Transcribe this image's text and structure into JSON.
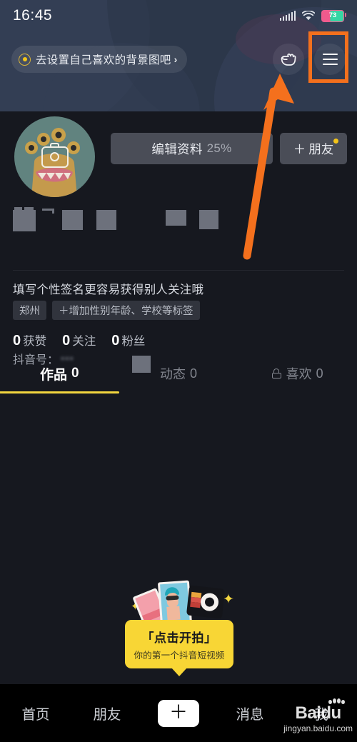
{
  "status_bar": {
    "time": "16:45",
    "signal_icon": "cellular-signal-icon",
    "wifi_icon": "wifi-icon",
    "battery_icon": "battery-icon",
    "battery_level": "73"
  },
  "banner": {
    "chip_text": "去设置自己喜欢的背景图吧",
    "chip_arrow": "›",
    "chip_dot_icon": "yellow-dot-icon",
    "hand_icon": "pointing-hand-icon",
    "menu_icon": "hamburger-menu-icon",
    "background_color": "#2f3b4e"
  },
  "profile": {
    "avatar_icon": "avatar-camera-icon",
    "avatar_bg": "#61837f",
    "edit_button": "编辑资料",
    "edit_percent": "25%",
    "friend_button_plus": "＋",
    "friend_button": "朋友",
    "friend_badge_color": "#f5c518",
    "username_redacted": true,
    "douyin_id_label": "抖音号：",
    "douyin_id_value": "•••",
    "signature_placeholder": "填写个性签名更容易获得别人关注哦",
    "tags": [
      {
        "label": "郑州",
        "name": "tag-city"
      },
      {
        "label": "＋增加性别年龄、学校等标签",
        "name": "tag-add-attributes"
      }
    ],
    "stats": [
      {
        "num": "0",
        "label": "获赞",
        "name": "stat-likes"
      },
      {
        "num": "0",
        "label": "关注",
        "name": "stat-following"
      },
      {
        "num": "0",
        "label": "粉丝",
        "name": "stat-followers"
      }
    ]
  },
  "tabs": {
    "items": [
      {
        "label": "作品",
        "count": "0",
        "active": true,
        "lock": false
      },
      {
        "label": "动态",
        "count": "0",
        "active": false,
        "lock": false
      },
      {
        "label": "喜欢",
        "count": "0",
        "active": false,
        "lock": true
      }
    ],
    "active_underline_color": "#f3d63f"
  },
  "cta": {
    "title": "「点击开拍」",
    "subtitle": "你的第一个抖音短视频",
    "bg_color": "#f8d635",
    "art_icon": "photo-cards-camera-icon"
  },
  "bottom_nav": {
    "items": [
      {
        "label": "首页",
        "name": "nav-home"
      },
      {
        "label": "朋友",
        "name": "nav-friends"
      },
      {
        "label": "＋",
        "name": "nav-create"
      },
      {
        "label": "消息",
        "name": "nav-messages"
      },
      {
        "label": "我",
        "name": "nav-profile"
      }
    ]
  },
  "watermark": {
    "brand": "Baidu",
    "url": "jingyan.baidu.com"
  },
  "annotation": {
    "highlight_color": "#f4701d",
    "target": "hamburger-menu-icon"
  }
}
